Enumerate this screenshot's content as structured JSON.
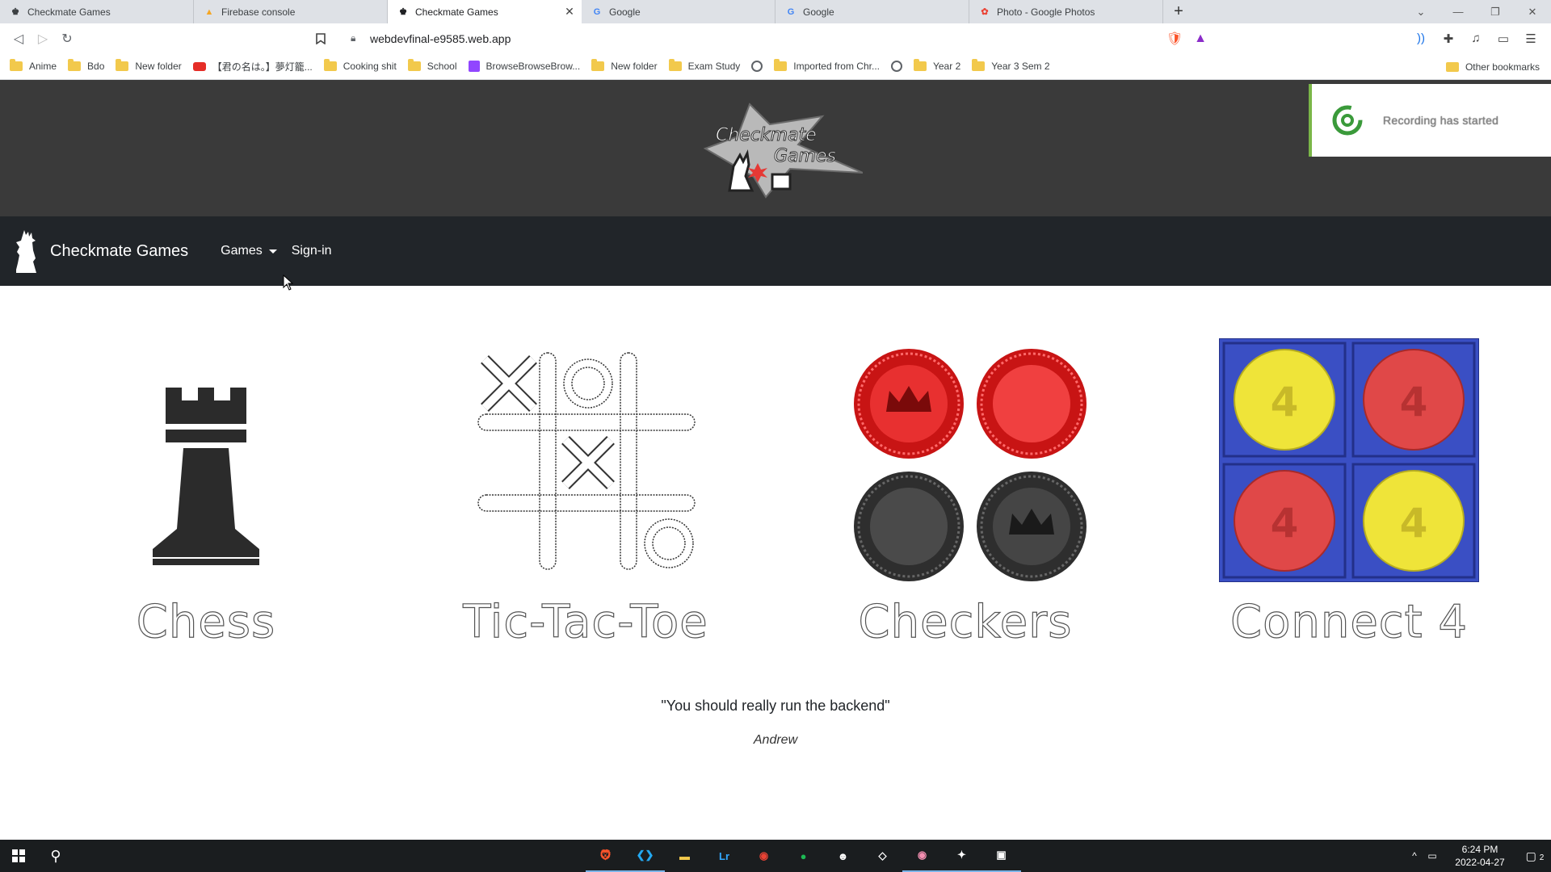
{
  "browser": {
    "tabs": [
      {
        "title": "Checkmate Games",
        "favicon": "chess-king-icon",
        "active": false
      },
      {
        "title": "Firebase console",
        "favicon": "firebase-icon",
        "active": false
      },
      {
        "title": "Checkmate Games",
        "favicon": "chess-king-icon",
        "active": true
      },
      {
        "title": "Google",
        "favicon": "google-icon",
        "active": false
      },
      {
        "title": "Google",
        "favicon": "google-icon",
        "active": false
      },
      {
        "title": "Photo - Google Photos",
        "favicon": "google-photos-icon",
        "active": false
      }
    ],
    "url": "webdevfinal-e9585.web.app",
    "brave_shield_count": "1",
    "bookmarks": [
      {
        "label": "Anime",
        "icon": "folder-icon"
      },
      {
        "label": "Bdo",
        "icon": "folder-icon"
      },
      {
        "label": "New folder",
        "icon": "folder-icon"
      },
      {
        "label": "【君の名は。】夢灯籠...",
        "icon": "youtube-icon"
      },
      {
        "label": "Cooking shit",
        "icon": "folder-icon"
      },
      {
        "label": "School",
        "icon": "folder-icon"
      },
      {
        "label": "BrowseBrowseBrow...",
        "icon": "twitch-icon"
      },
      {
        "label": "New folder",
        "icon": "folder-icon"
      },
      {
        "label": "Exam Study",
        "icon": "folder-icon"
      },
      {
        "label": "",
        "icon": "globe-icon"
      },
      {
        "label": "Imported from Chr...",
        "icon": "folder-icon"
      },
      {
        "label": "",
        "icon": "globe-icon"
      },
      {
        "label": "Year 2",
        "icon": "folder-icon"
      },
      {
        "label": "Year 3 Sem 2",
        "icon": "folder-icon"
      }
    ],
    "other_bookmarks": "Other bookmarks"
  },
  "site": {
    "logo_line1": "Checkmate",
    "logo_line2": "Games",
    "toast": "Recording has started",
    "brand": "Checkmate Games",
    "nav": {
      "games": "Games",
      "signin": "Sign-in"
    },
    "games": [
      {
        "name": "Chess",
        "icon": "chess-rook-icon"
      },
      {
        "name": "Tic-Tac-Toe",
        "icon": "tic-tac-toe-icon"
      },
      {
        "name": "Checkers",
        "icon": "checkers-icon"
      },
      {
        "name": "Connect 4",
        "icon": "connect-four-icon"
      }
    ],
    "quote": "\"You should really run the backend\"",
    "author": "Andrew",
    "connect4_chip": "4"
  },
  "taskbar": {
    "time": "6:24 PM",
    "date": "2022-04-27",
    "notifications": "2",
    "apps": [
      "brave-icon",
      "vscode-icon",
      "file-explorer-icon",
      "lightroom-icon",
      "chrome-icon",
      "spotify-icon",
      "discord-bot-icon",
      "unity-icon",
      "chrome-alt-icon",
      "anime-app-icon",
      "screen-recorder-icon"
    ]
  },
  "colors": {
    "header_bg": "#3a3a3a",
    "navbar_bg": "#212529",
    "checker_red": "#e02020",
    "checker_black": "#3a3a3a",
    "connect4_board": "#3a4fc4",
    "connect4_yellow": "#f0e63a",
    "connect4_red": "#e04848"
  }
}
